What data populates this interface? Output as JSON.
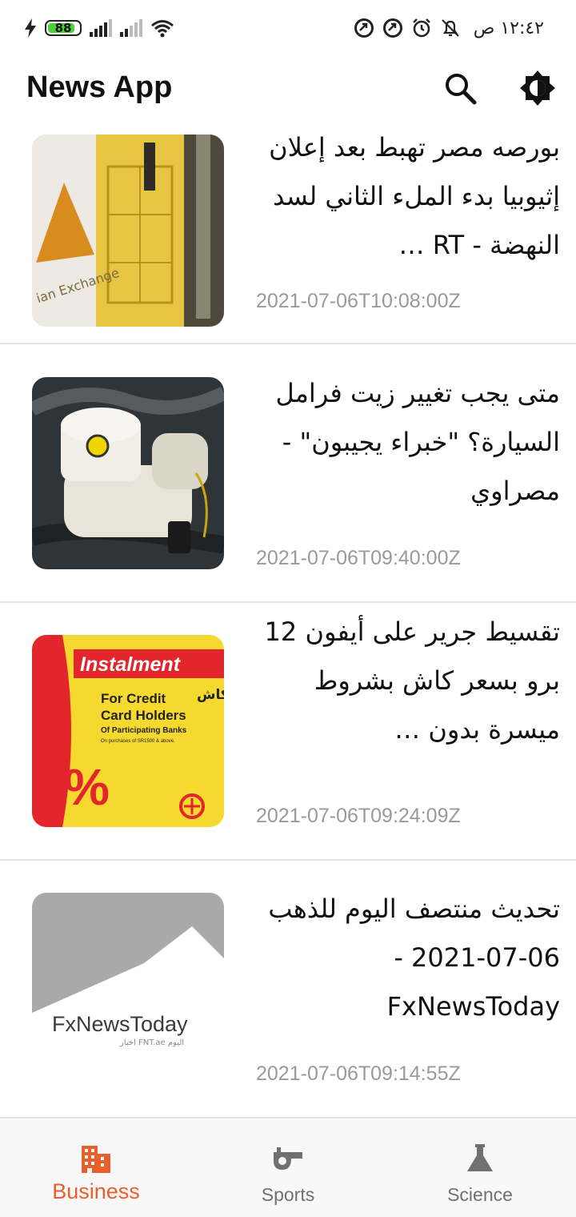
{
  "status_bar": {
    "battery_level": "88",
    "time": "١٢:٤٢ ص",
    "colors": {
      "battery_fill": "#4cd137"
    }
  },
  "app_bar": {
    "title": "News App",
    "search_icon": "search-icon",
    "theme_icon": "brightness-icon"
  },
  "articles": [
    {
      "title": "بورصه مصر تهبط بعد إعلان إثيوبيا بدء الملء الثاني لسد النهضة - RT …",
      "published_at": "2021-07-06T10:08:00Z",
      "image": "egyptian-exchange-photo"
    },
    {
      "title": "متى يجب تغيير زيت فرامل السيارة؟ \"خبراء يجيبون\" - مصراوي",
      "published_at": "2021-07-06T09:40:00Z",
      "image": "brake-fluid-reservoir-photo"
    },
    {
      "title": "تقسيط جرير على أيفون 12 برو بسعر كاش بشروط ميسرة بدون …",
      "published_at": "2021-07-06T09:24:09Z",
      "image": "jarir-instalment-ad",
      "image_text": {
        "banner": "Instalment",
        "line1": "For Credit",
        "line2": "Card Holders",
        "line3": "Of Participating Banks",
        "line4": "On purchases of SR1500 & above.",
        "percent": "%",
        "arabic": "كاش"
      }
    },
    {
      "title": "تحديث منتصف اليوم للذهب 06-07-2021 - FxNewsToday",
      "published_at": "2021-07-06T09:14:55Z",
      "image": "fxnewstoday-logo",
      "image_text": {
        "logo": "FxNewsToday",
        "tagline": "اخبار FNT.ae اليوم"
      }
    }
  ],
  "bottom_nav": {
    "items": [
      {
        "label": "Business",
        "icon": "buildings-icon",
        "active": true
      },
      {
        "label": "Sports",
        "icon": "whistle-icon",
        "active": false
      },
      {
        "label": "Science",
        "icon": "flask-icon",
        "active": false
      }
    ],
    "colors": {
      "active": "#e8602c",
      "inactive": "#707070"
    }
  }
}
